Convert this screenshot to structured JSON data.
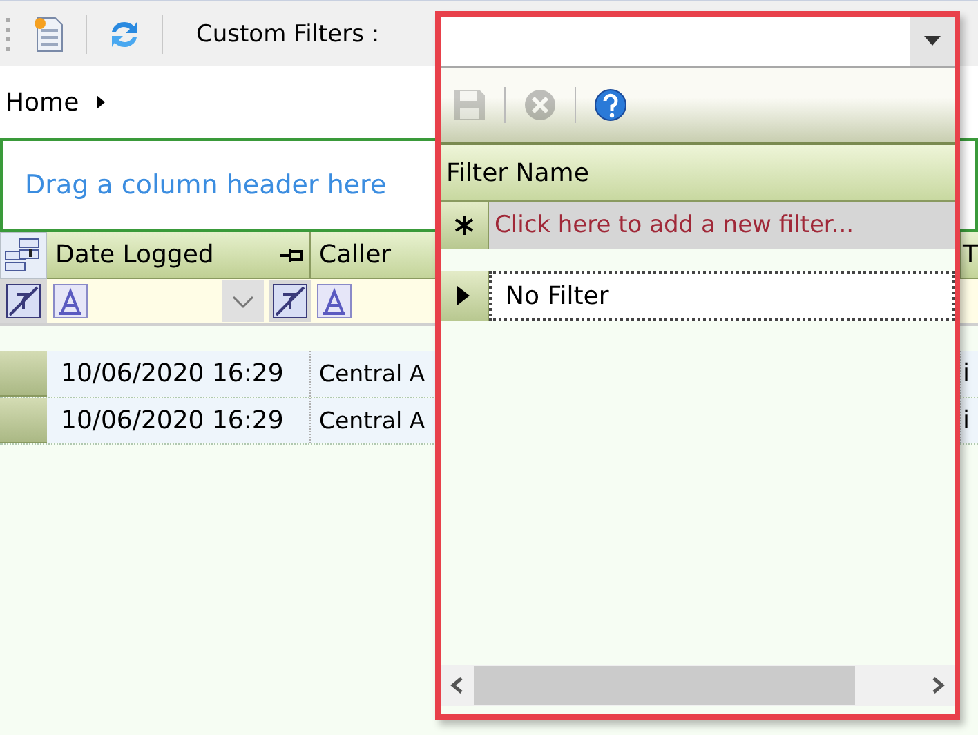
{
  "toolbar": {
    "label": "Custom Filters :"
  },
  "breadcrumb": {
    "items": [
      "Home"
    ]
  },
  "group_panel": {
    "hint": "Drag a column header here"
  },
  "grid": {
    "columns": [
      {
        "label": "Date Logged",
        "pinned": true
      },
      {
        "label": "Caller",
        "pinned": false
      },
      {
        "label": "T"
      }
    ],
    "rows": [
      {
        "cells": [
          "10/06/2020 16:29",
          "Central A",
          "i"
        ]
      },
      {
        "cells": [
          "10/06/2020 16:29",
          "Central A",
          "i"
        ]
      }
    ]
  },
  "filter_dropdown": {
    "tools": [
      {
        "kind": "save",
        "disabled": true
      },
      {
        "kind": "delete",
        "disabled": true
      },
      {
        "kind": "help",
        "disabled": false
      }
    ],
    "column": "Filter Name",
    "new_row_hint": "Click here to add a new filter...",
    "rows": [
      {
        "name": "No Filter",
        "selected": true
      }
    ]
  }
}
